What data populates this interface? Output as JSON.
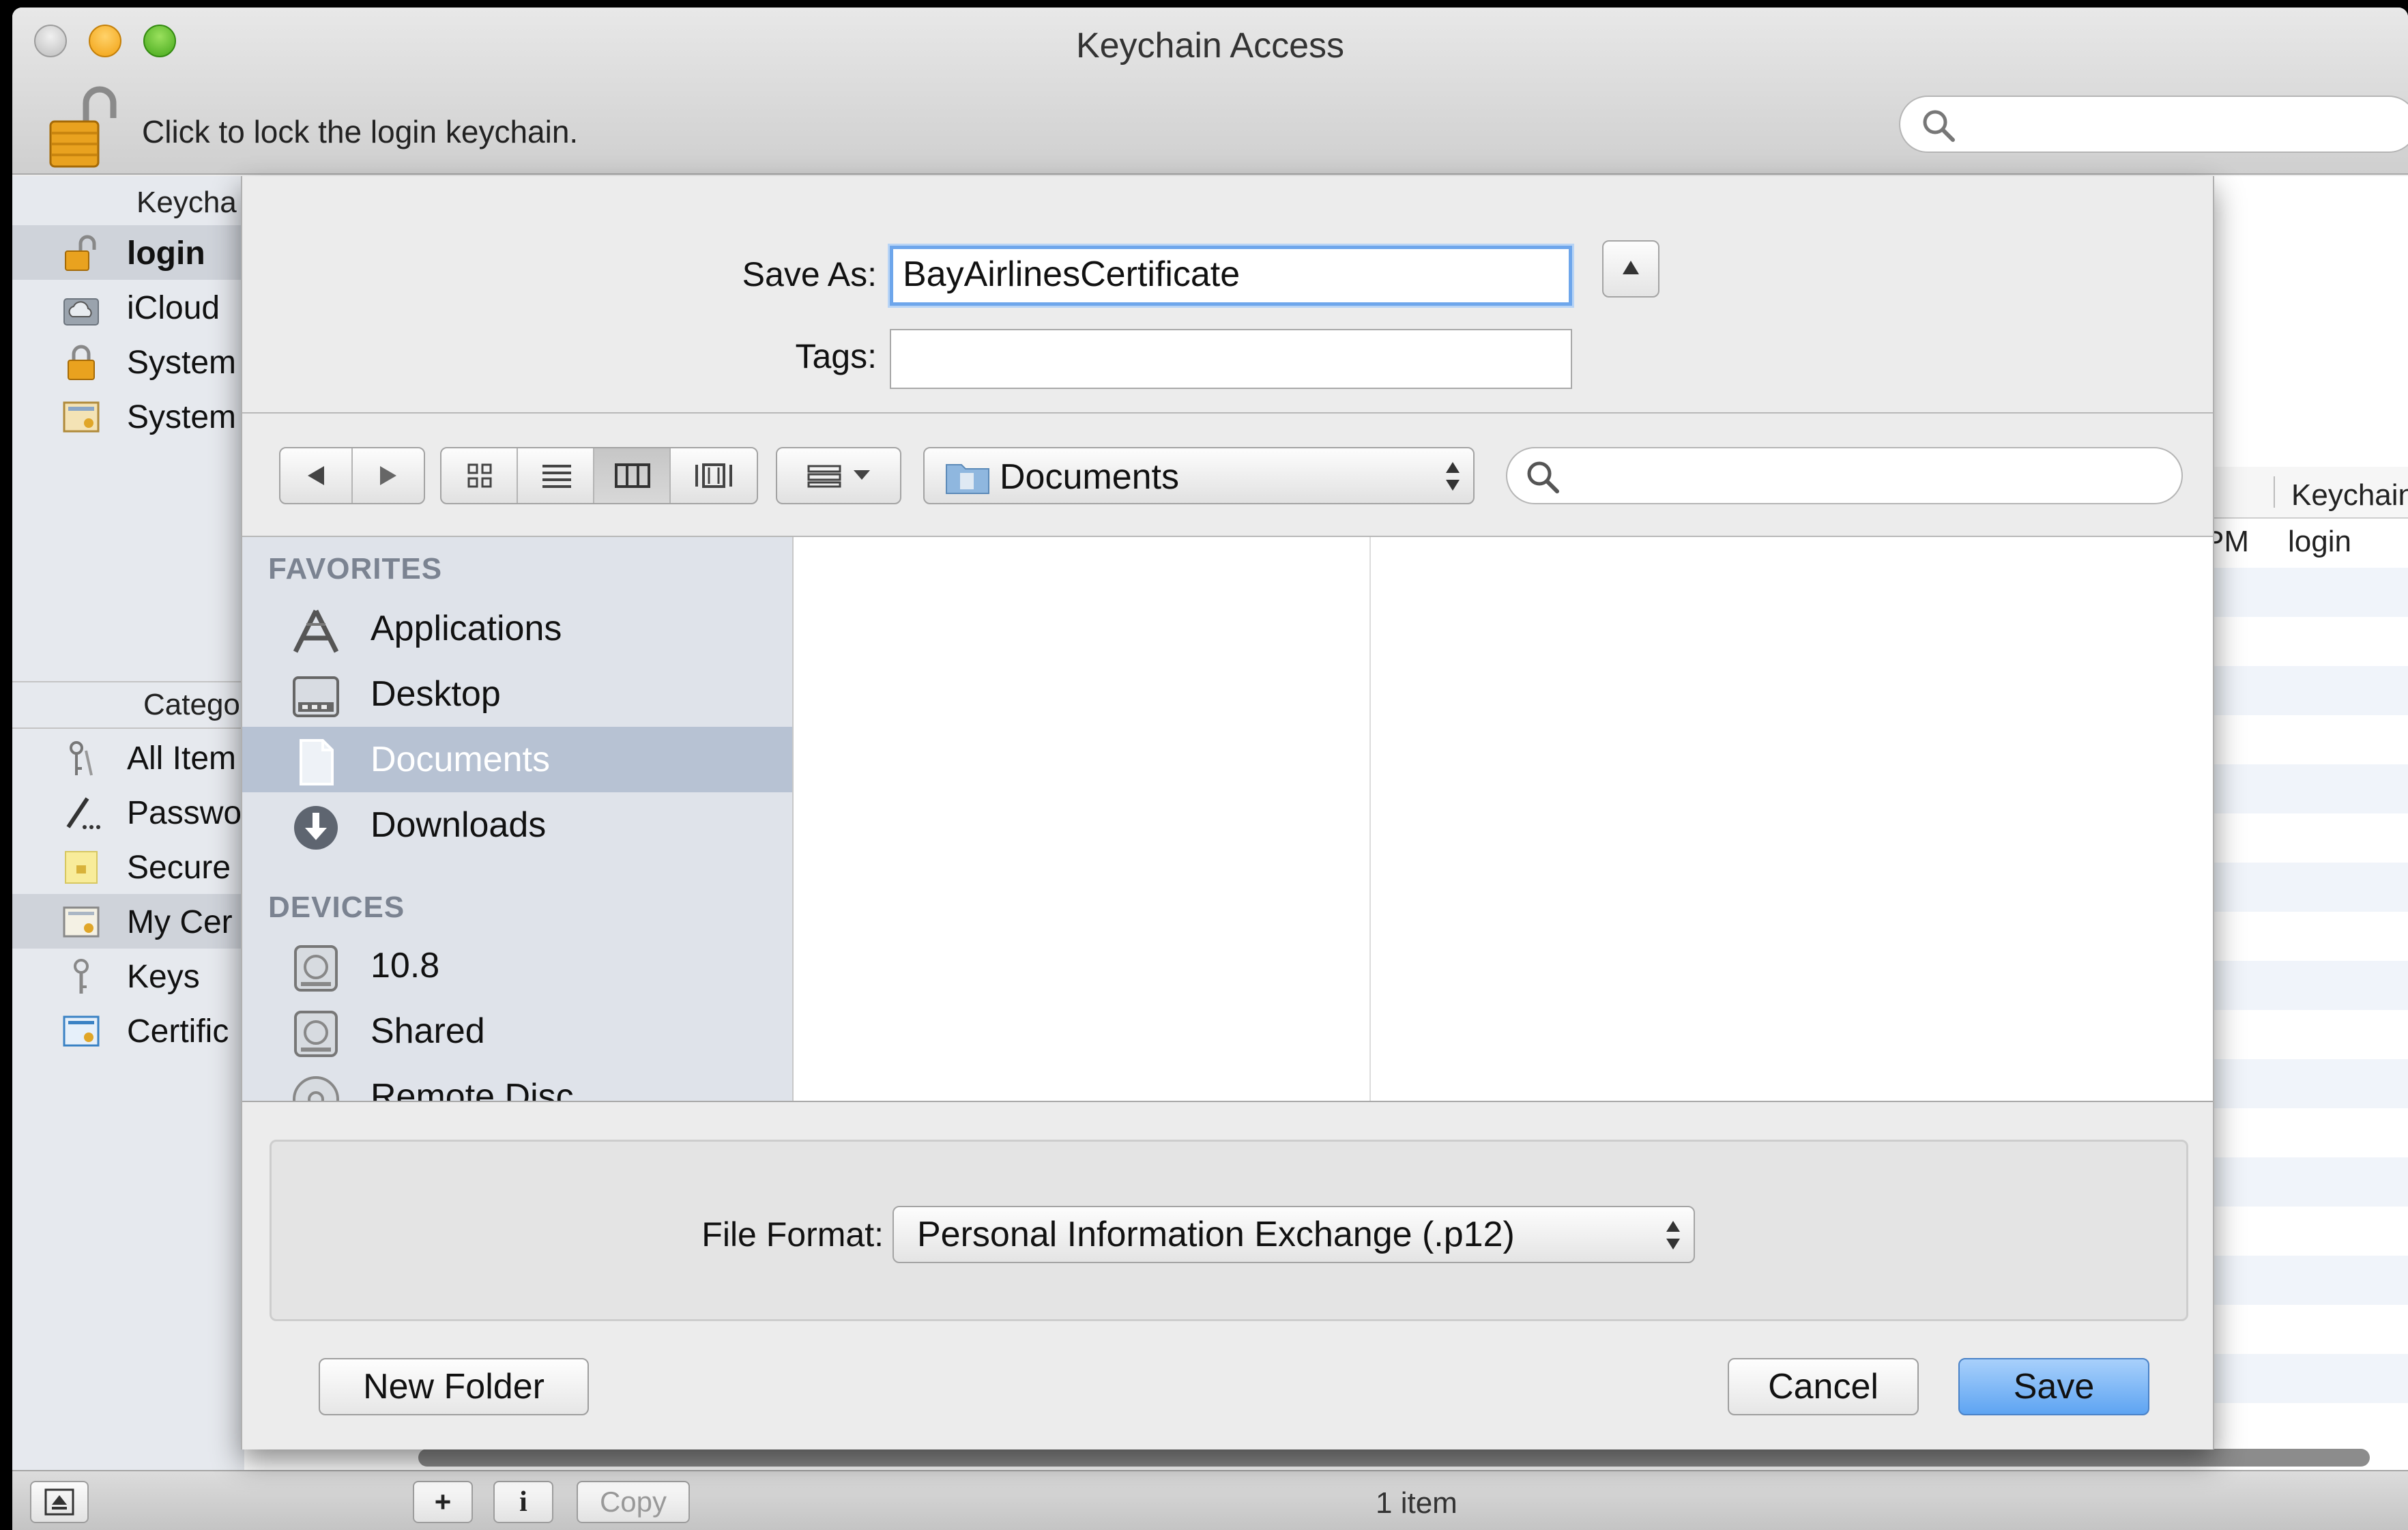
{
  "window": {
    "title": "Keychain Access",
    "lock_hint": "Click to lock the login keychain.",
    "search_placeholder": ""
  },
  "sidebar": {
    "keychains_header": "Keycha",
    "keychains": [
      {
        "label": "login",
        "icon": "unlocked-padlock-icon",
        "selected": true
      },
      {
        "label": "iCloud",
        "icon": "icloud-icon",
        "selected": false
      },
      {
        "label": "System",
        "icon": "padlock-icon",
        "selected": false
      },
      {
        "label": "System",
        "icon": "certificate-icon",
        "selected": false
      }
    ],
    "category_header": "Catego",
    "categories": [
      {
        "label": "All Item",
        "icon": "keys-icon",
        "selected": false
      },
      {
        "label": "Passwo",
        "icon": "pen-icon",
        "selected": false
      },
      {
        "label": "Secure",
        "icon": "note-icon",
        "selected": false
      },
      {
        "label": "My Cer",
        "icon": "certificate-icon",
        "selected": true
      },
      {
        "label": "Keys",
        "icon": "key-icon",
        "selected": false
      },
      {
        "label": "Certific",
        "icon": "certificate-icon",
        "selected": false
      }
    ]
  },
  "background_list": {
    "column_keychain": "Keychain",
    "row_time_fragment": "PM",
    "row_keychain": "login"
  },
  "save_sheet": {
    "save_as_label": "Save As:",
    "save_as_value": "BayAirlinesCertificate",
    "tags_label": "Tags:",
    "tags_value": "",
    "location": "Documents",
    "search_placeholder": "",
    "favorites_header": "FAVORITES",
    "favorites": [
      {
        "label": "Applications",
        "icon": "applications-icon",
        "selected": false
      },
      {
        "label": "Desktop",
        "icon": "desktop-icon",
        "selected": false
      },
      {
        "label": "Documents",
        "icon": "documents-icon",
        "selected": true
      },
      {
        "label": "Downloads",
        "icon": "downloads-icon",
        "selected": false
      }
    ],
    "devices_header": "DEVICES",
    "devices": [
      {
        "label": "10.8",
        "icon": "hard-drive-icon"
      },
      {
        "label": "Shared",
        "icon": "hard-drive-icon"
      },
      {
        "label": "Remote Disc",
        "icon": "disc-icon"
      }
    ],
    "file_format_label": "File Format:",
    "file_format_value": "Personal Information Exchange (.p12)",
    "new_folder_label": "New Folder",
    "cancel_label": "Cancel",
    "save_label": "Save"
  },
  "bottom_bar": {
    "add_label": "+",
    "info_label": "i",
    "copy_label": "Copy",
    "item_count": "1 item"
  },
  "colors": {
    "accent_blue": "#5ea4f2",
    "focus_ring": "#6ea6eb",
    "sidebar_bg": "#dfe3ea",
    "selected_row": "#b7c2d3"
  }
}
